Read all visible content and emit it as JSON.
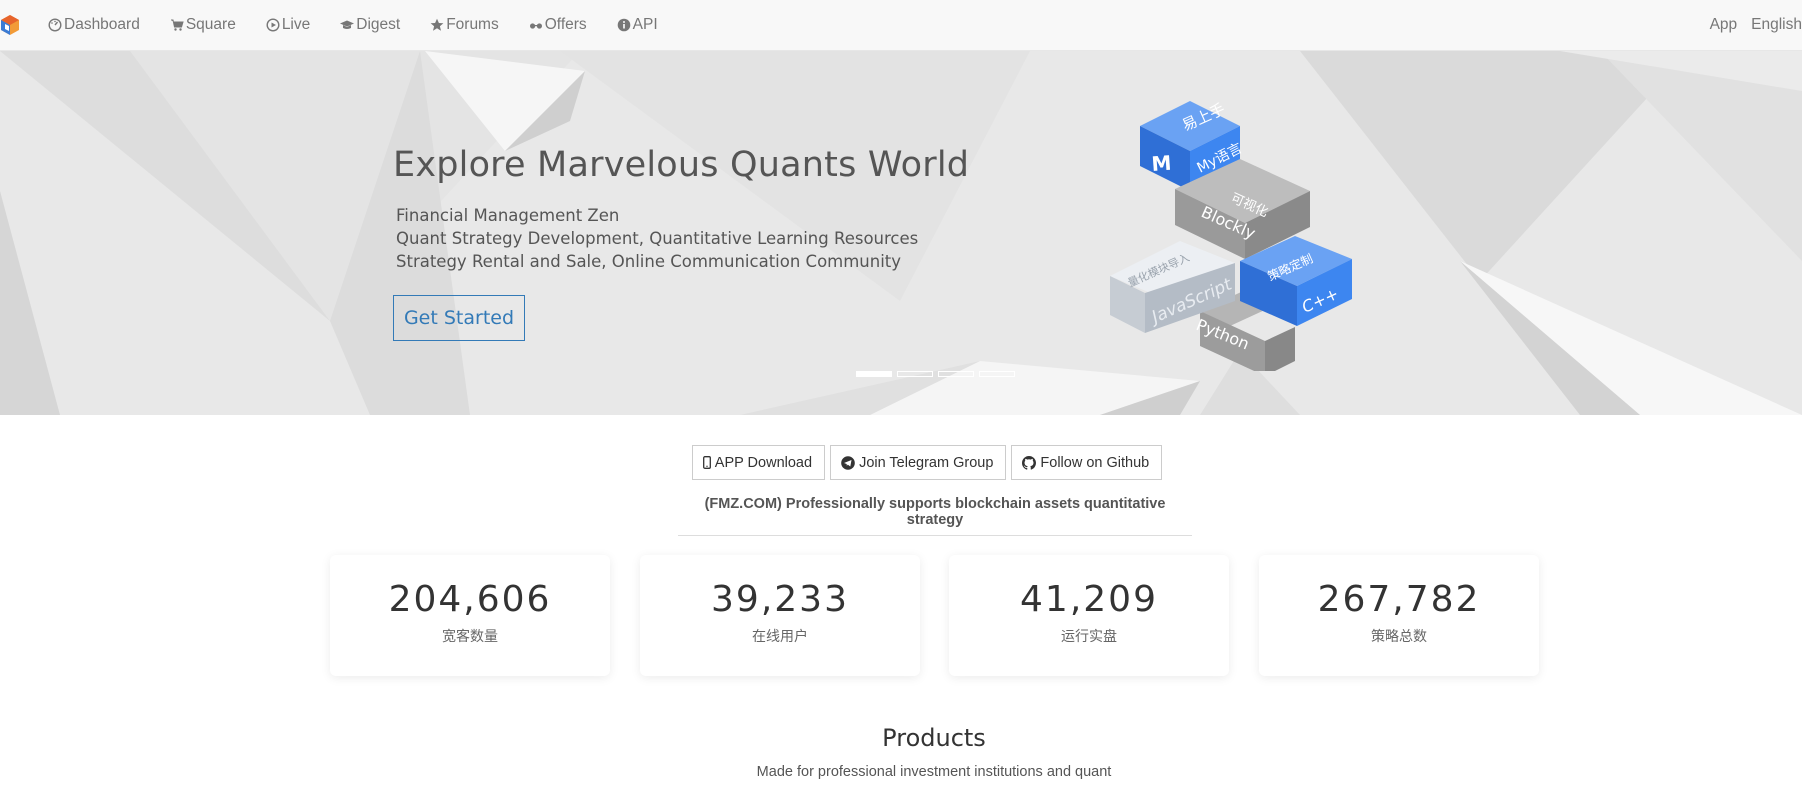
{
  "navbar": {
    "items": [
      {
        "label": "Dashboard",
        "icon": "dashboard-icon"
      },
      {
        "label": "Square",
        "icon": "cart-icon"
      },
      {
        "label": "Live",
        "icon": "play-circle-icon"
      },
      {
        "label": "Digest",
        "icon": "graduation-cap-icon"
      },
      {
        "label": "Forums",
        "icon": "star-icon"
      },
      {
        "label": "Offers",
        "icon": "glasses-icon"
      },
      {
        "label": "API",
        "icon": "info-circle-icon"
      }
    ],
    "right": {
      "app": "App",
      "language": "English"
    }
  },
  "hero": {
    "title": "Explore Marvelous Quants World",
    "lines": [
      "Financial Management Zen",
      "Quant Strategy Development, Quantitative Learning Resources",
      "Strategy Rental and Sale, Online Communication Community"
    ],
    "cta": "Get Started",
    "illustration_labels": [
      "易上手",
      "My语言",
      "可视化",
      "Blockly",
      "量化模块导入",
      "JavaScript",
      "策略定制",
      "C++",
      "Python"
    ],
    "carousel_count": 4,
    "carousel_active": 1
  },
  "actions": {
    "app_download": "APP Download",
    "telegram": "Join Telegram Group",
    "github": "Follow on Github",
    "tagline": "(FMZ.COM) Professionally supports blockchain assets quantitative strategy"
  },
  "stats": [
    {
      "value": "204,606",
      "label": "宽客数量"
    },
    {
      "value": "39,233",
      "label": "在线用户"
    },
    {
      "value": "41,209",
      "label": "运行实盘"
    },
    {
      "value": "267,782",
      "label": "策略总数"
    }
  ],
  "products": {
    "title": "Products",
    "subtitle": "Made for professional investment institutions and quant"
  },
  "colors": {
    "accent": "#337ab7",
    "block_blue": "#3d86f0",
    "block_gray": "#9a9a9a",
    "block_light": "#c9cfd6",
    "hero_bg": "#e9e9e9"
  }
}
